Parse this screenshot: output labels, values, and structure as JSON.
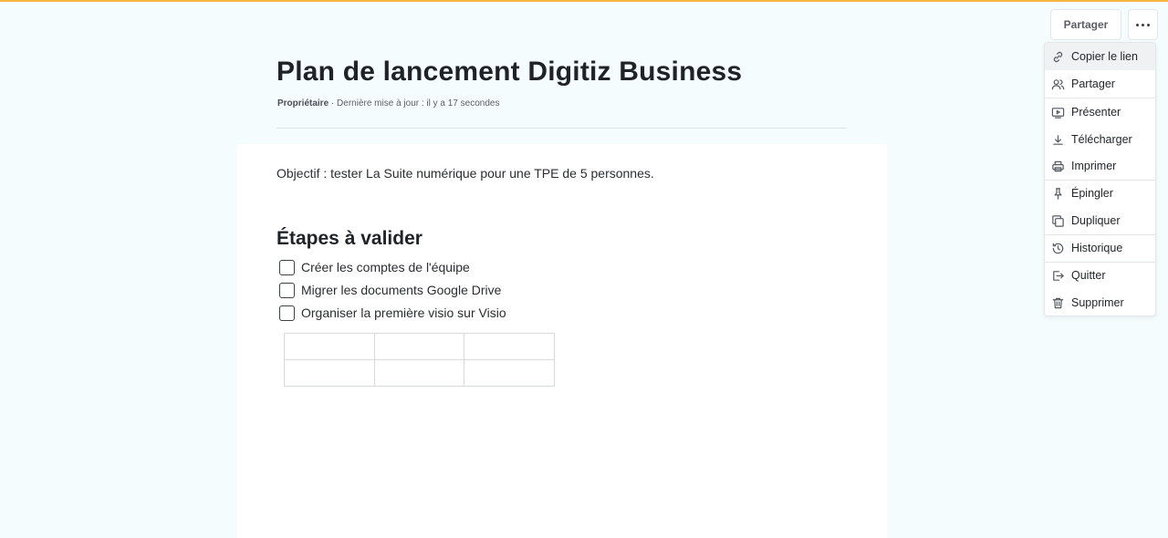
{
  "header": {
    "share_label": "Partager",
    "more_icon": "more-horizontal-icon"
  },
  "document": {
    "title": "Plan de lancement Digitiz Business",
    "owner": "Propriétaire",
    "separator": "·",
    "updated": "Dernière mise à jour : il y a 17 secondes",
    "objective": "Objectif : tester La Suite numérique pour une TPE de 5 personnes.",
    "section_heading": "Étapes à valider",
    "checklist": [
      {
        "label": "Créer les comptes de l'équipe",
        "checked": false
      },
      {
        "label": "Migrer les documents Google Drive",
        "checked": false
      },
      {
        "label": "Organiser la première visio sur Visio",
        "checked": false
      }
    ],
    "table": {
      "rows": 2,
      "cols": 3,
      "cells": [
        [
          "",
          "",
          ""
        ],
        [
          "",
          "",
          ""
        ]
      ]
    }
  },
  "menu": {
    "items": [
      {
        "label": "Copier le lien",
        "icon": "link-icon"
      },
      {
        "label": "Partager",
        "icon": "users-icon"
      },
      {
        "label": "Présenter",
        "icon": "present-icon"
      },
      {
        "label": "Télécharger",
        "icon": "download-icon"
      },
      {
        "label": "Imprimer",
        "icon": "printer-icon"
      },
      {
        "label": "Épingler",
        "icon": "pin-icon"
      },
      {
        "label": "Dupliquer",
        "icon": "duplicate-icon"
      },
      {
        "label": "Historique",
        "icon": "history-icon"
      },
      {
        "label": "Quitter",
        "icon": "exit-icon"
      },
      {
        "label": "Supprimer",
        "icon": "trash-icon"
      }
    ]
  },
  "colors": {
    "background": "#f5fcfd",
    "accent_bar": "#f6b53c",
    "text": "#1e1e1e",
    "menu_hover": "#eff1f3"
  }
}
